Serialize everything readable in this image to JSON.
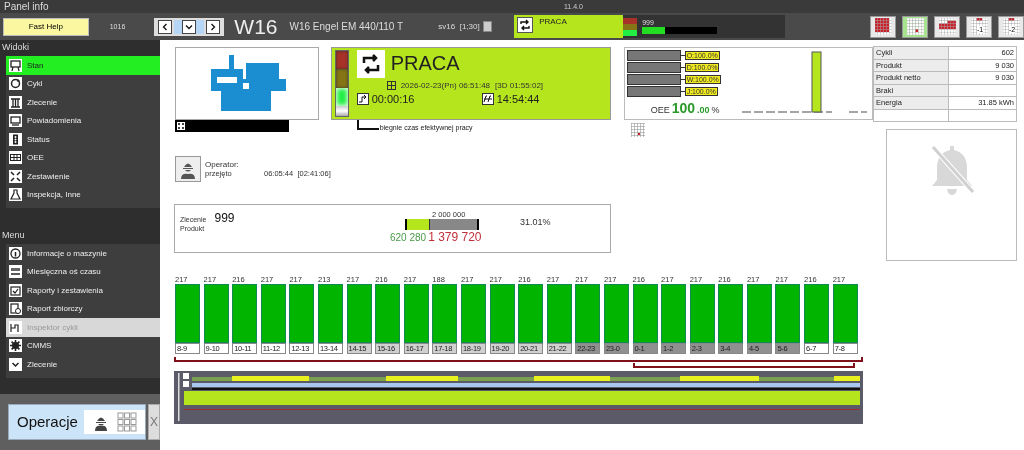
{
  "window": {
    "title": "Panel info",
    "version": "11.4.0"
  },
  "header": {
    "help_button": "Fast Help",
    "code": "1016",
    "machine_id": "W16",
    "machine_name": "W16 Engel EM 440/110 T",
    "sv_label": "sv16",
    "sv_value": "[1;30]",
    "sv_checked": false,
    "status": "PRACA",
    "counter": "999",
    "progress": {
      "level": 0.3
    }
  },
  "toolbar": [
    {
      "selected": false
    },
    {
      "selected": true
    },
    {
      "selected": false
    },
    {
      "label": "-1",
      "selected": false
    },
    {
      "label": "-2",
      "selected": false
    }
  ],
  "sidebar": {
    "sections": [
      {
        "title": "Widoki",
        "items": [
          {
            "label": "Stan",
            "selected": true
          },
          {
            "label": "Cykl",
            "selected": false
          },
          {
            "label": "Zlecenie",
            "selected": false
          },
          {
            "label": "Powiadomienia",
            "selected": false
          },
          {
            "label": "Status",
            "selected": false
          },
          {
            "label": "OEE",
            "selected": false
          },
          {
            "label": "Zestawienie",
            "selected": false
          },
          {
            "label": "Inspekcja, Inne",
            "selected": false
          }
        ]
      },
      {
        "title": "Menu",
        "items": [
          {
            "label": "Informacje o maszynie",
            "disabled": false
          },
          {
            "label": "Miesięczna oś czasu",
            "disabled": false
          },
          {
            "label": "Raporty i zestawienia",
            "disabled": false
          },
          {
            "label": "Raport zbiorczy",
            "disabled": false
          },
          {
            "label": "Inspektor cykli",
            "disabled": true
          },
          {
            "label": "CMMS",
            "disabled": false
          },
          {
            "label": "Zlecenie",
            "disabled": false
          }
        ]
      }
    ],
    "operations_button": "Operacje",
    "close_button": "X"
  },
  "status_panel": {
    "lamps": [
      {
        "color": "#a83228",
        "on": false
      },
      {
        "color": "#857515",
        "on": false
      },
      {
        "color": "#22ee44",
        "on": true
      }
    ],
    "state": "PRACA",
    "datetime": "2026-02-23(Pn) 06:51:48",
    "duration": "[3D 01:55:02]",
    "elapsed": "00:00:16",
    "clock": "14:54:44",
    "caption": "biegnie czas efektywnej pracy"
  },
  "oee": {
    "bars": [
      {
        "label": "O:100.0%",
        "level": 1
      },
      {
        "label": "D:100.0%",
        "level": 1
      },
      {
        "label": "W:100.0%",
        "level": 1
      },
      {
        "label": "J:100.0%",
        "level": 1
      }
    ],
    "label": "OEE",
    "value": "100",
    "decimals": ".00",
    "unit": "%"
  },
  "stats": [
    {
      "label": "Cykli",
      "value": "602"
    },
    {
      "label": "Produkt",
      "value": "9 030"
    },
    {
      "label": "Produkt netto",
      "value": "9 030"
    },
    {
      "label": "Braki"
    },
    {
      "label": "Energia",
      "value": "31.85 kWh"
    }
  ],
  "operator": {
    "label": "Operator:",
    "status": "przejęto",
    "time": "06:05:44",
    "duration": "[02:41:06]"
  },
  "order": {
    "label": "Zlecenie",
    "number": "999",
    "product_label": "Produkt",
    "target": "2 000 000",
    "done": "620 280",
    "remaining": "1 379 720",
    "percent": "31.01%",
    "level": 0.31
  },
  "hours": [
    {
      "label": "8-9",
      "count": "217",
      "kind": "first"
    },
    {
      "label": "9-10",
      "count": "217",
      "kind": "first"
    },
    {
      "label": "10-11",
      "count": "216",
      "kind": "first"
    },
    {
      "label": "11-12",
      "count": "217",
      "kind": "first"
    },
    {
      "label": "12-13",
      "count": "217",
      "kind": "first"
    },
    {
      "label": "13-14",
      "count": "213",
      "kind": "first"
    },
    {
      "label": "14-15",
      "count": "217",
      "kind": "second"
    },
    {
      "label": "15-16",
      "count": "216",
      "kind": "second"
    },
    {
      "label": "16-17",
      "count": "217",
      "kind": "second"
    },
    {
      "label": "17-18",
      "count": "188",
      "kind": "second"
    },
    {
      "label": "18-19",
      "count": "217",
      "kind": "second"
    },
    {
      "label": "19-20",
      "count": "217",
      "kind": "second"
    },
    {
      "label": "20-21",
      "count": "216",
      "kind": "second"
    },
    {
      "label": "21-22",
      "count": "217",
      "kind": "second"
    },
    {
      "label": "22-23",
      "count": "217",
      "kind": "third"
    },
    {
      "label": "23-0",
      "count": "217",
      "kind": "third"
    },
    {
      "label": "0-1",
      "count": "216",
      "kind": "third"
    },
    {
      "label": "1-2",
      "count": "217",
      "kind": "third"
    },
    {
      "label": "2-3",
      "count": "217",
      "kind": "third"
    },
    {
      "label": "3-4",
      "count": "216",
      "kind": "third"
    },
    {
      "label": "4-5",
      "count": "217",
      "kind": "third"
    },
    {
      "label": "5-6",
      "count": "217",
      "kind": "third"
    },
    {
      "label": "6-7",
      "count": "216",
      "kind": "first"
    },
    {
      "label": "7-8",
      "count": "217",
      "kind": "first"
    }
  ]
}
